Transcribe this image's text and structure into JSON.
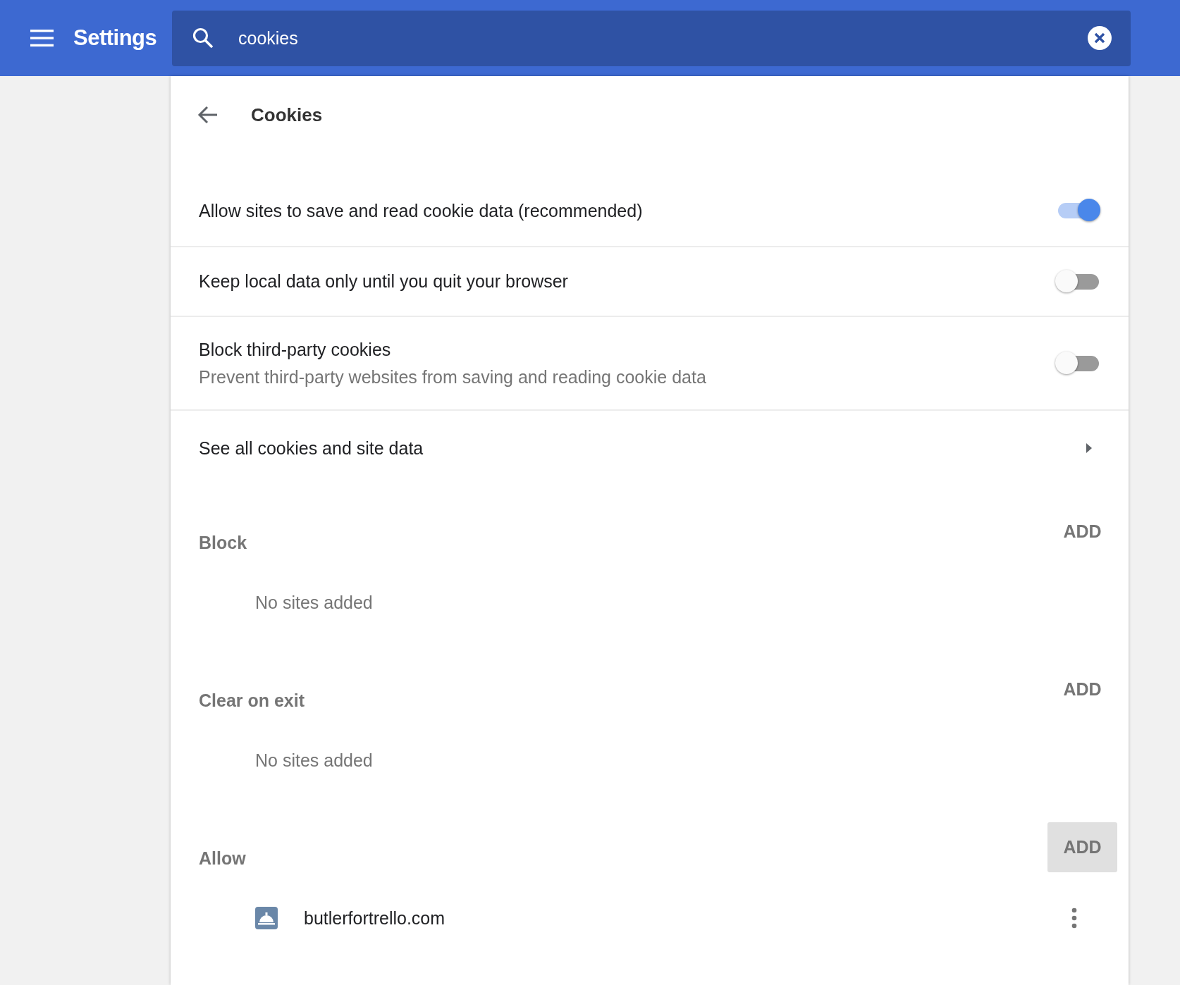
{
  "header": {
    "title": "Settings",
    "search": {
      "value": "cookies"
    }
  },
  "page": {
    "title": "Cookies"
  },
  "toggles": [
    {
      "label": "Allow sites to save and read cookie data (recommended)",
      "on": true
    },
    {
      "label": "Keep local data only until you quit your browser",
      "on": false
    },
    {
      "label": "Block third-party cookies",
      "description": "Prevent third-party websites from saving and reading cookie data",
      "on": false
    }
  ],
  "link_row": {
    "label": "See all cookies and site data"
  },
  "sections": [
    {
      "title": "Block",
      "add_button": {
        "label": "ADD",
        "hovered": false
      },
      "empty_text": "No sites added"
    },
    {
      "title": "Clear on exit",
      "add_button": {
        "label": "ADD",
        "hovered": false
      },
      "empty_text": "No sites added"
    },
    {
      "title": "Allow",
      "add_button": {
        "label": "ADD",
        "hovered": true
      },
      "sites": [
        {
          "name": "butlerfortrello.com"
        }
      ]
    }
  ]
}
